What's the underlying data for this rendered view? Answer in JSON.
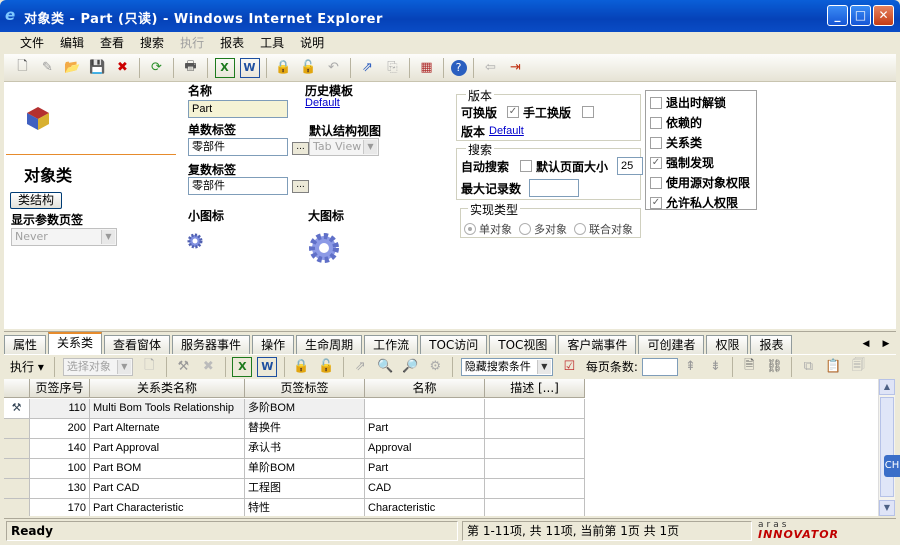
{
  "window": {
    "title": "对象类 - Part (只读) - Windows Internet Explorer",
    "min": "_",
    "max": "□",
    "close": "✕"
  },
  "menu": [
    "文件",
    "编辑",
    "查看",
    "搜索",
    "执行",
    "报表",
    "工具",
    "说明"
  ],
  "menu_disabled": [
    "执行"
  ],
  "form": {
    "header_title": "对象类",
    "class_structure_btn": "类结构",
    "show_params_label": "显示参数页签",
    "show_params_value": "Never",
    "name_label": "名称",
    "name_value": "Part",
    "history_template_label": "历史模板",
    "history_template_value": "Default",
    "singular_label_label": "单数标签",
    "singular_label_value": "零部件",
    "default_structure_view_label": "默认结构视图",
    "default_structure_view_value": "Tab View",
    "plural_label_label": "复数标签",
    "plural_label_value": "零部件",
    "small_icon_label": "小图标",
    "large_icon_label": "大图标",
    "version_group": "版本",
    "versionable_label": "可换版",
    "manual_version_label": "手工换版",
    "version_label": "版本",
    "version_value": "Default",
    "search_group": "搜索",
    "auto_search_label": "自动搜索",
    "default_page_size_label": "默认页面大小",
    "default_page_size_value": "25",
    "max_records_label": "最大记录数",
    "max_records_value": "",
    "impl_group": "实现类型",
    "impl_options": [
      "单对象",
      "多对象",
      "联合对象"
    ],
    "checks": [
      {
        "label": "退出时解锁",
        "checked": false
      },
      {
        "label": "依赖的",
        "checked": false
      },
      {
        "label": "关系类",
        "checked": false
      },
      {
        "label": "强制发现",
        "checked": true
      },
      {
        "label": "使用源对象权限",
        "checked": false
      },
      {
        "label": "允许私人权限",
        "checked": true
      }
    ]
  },
  "tabs": [
    "属性",
    "关系类",
    "查看窗体",
    "服务器事件",
    "操作",
    "生命周期",
    "工作流",
    "TOC访问",
    "TOC视图",
    "客户端事件",
    "可创建者",
    "权限",
    "报表"
  ],
  "active_tab": "关系类",
  "subtoolbar": {
    "exec": "执行 ▾",
    "pick": "选择对象",
    "hidden_search": "隐藏搜索条件",
    "page_size": "每页条数:"
  },
  "grid": {
    "headers": [
      "页签序号",
      "关系类名称",
      "页签标签",
      "名称",
      "描述 [...]"
    ],
    "rows": [
      [
        "110",
        "Multi Bom Tools Relationship",
        "多阶BOM",
        ""
      ],
      [
        "200",
        "Part Alternate",
        "替换件",
        "Part"
      ],
      [
        "140",
        "Part Approval",
        "承认书",
        "Approval"
      ],
      [
        "100",
        "Part BOM",
        "单阶BOM",
        "Part"
      ],
      [
        "130",
        "Part CAD",
        "工程图",
        "CAD"
      ],
      [
        "170",
        "Part Characteristic",
        "特性",
        "Characteristic"
      ]
    ]
  },
  "status": {
    "ready": "Ready",
    "paging": "第 1-11项, 共 11项, 当前第 1页 共 1页",
    "brand_top": "aras",
    "brand": "INNOVATOR",
    "side_tab": "CH"
  },
  "colors": {
    "titlebar": "#0542b8",
    "accent_tab": "#e68b2c",
    "brand": "#c00000"
  }
}
